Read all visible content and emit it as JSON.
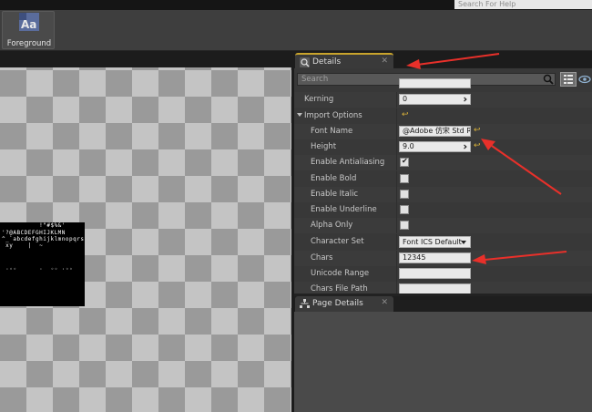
{
  "search_help": {
    "placeholder": "Search For Help"
  },
  "toolbar": {
    "foreground_label": "Foreground",
    "foreground_icon": "font-aa-icon"
  },
  "details": {
    "tab_label": "Details",
    "search_placeholder": "Search",
    "rows": [
      {
        "label": "Kerning",
        "value": "0",
        "type": "number"
      },
      {
        "label": "Import Options",
        "type": "category"
      },
      {
        "label": "Font Name",
        "value": "@Adobe 仿宋 Std R",
        "type": "text"
      },
      {
        "label": "Height",
        "value": "9.0",
        "type": "number"
      },
      {
        "label": "Enable Antialiasing",
        "checked": true,
        "type": "checkbox"
      },
      {
        "label": "Enable Bold",
        "checked": false,
        "type": "checkbox"
      },
      {
        "label": "Enable Italic",
        "checked": false,
        "type": "checkbox"
      },
      {
        "label": "Enable Underline",
        "checked": false,
        "type": "checkbox"
      },
      {
        "label": "Alpha Only",
        "checked": false,
        "type": "checkbox"
      },
      {
        "label": "Character Set",
        "value": "Font ICS Default",
        "type": "dropdown"
      },
      {
        "label": "Chars",
        "value": "12345",
        "type": "text"
      },
      {
        "label": "Unicode Range",
        "value": "",
        "type": "text"
      },
      {
        "label": "Chars File Path",
        "value": "",
        "type": "text"
      }
    ]
  },
  "page_details": {
    "tab_label": "Page Details"
  },
  "atlas": {
    "lines": [
      "          !\"#$%&'",
      "'?@ABCDEFGHIJKLMN",
      "^_`abcdefghijklmnopqrs",
      " xy    |  ~",
      " ",
      " ·◦◦      ·  ◦◦ ·◦◦"
    ]
  },
  "colors": {
    "accent_tab": "#c9a42c",
    "annotation_arrow": "#e8302a",
    "reset_arrow": "#d8b13a"
  }
}
